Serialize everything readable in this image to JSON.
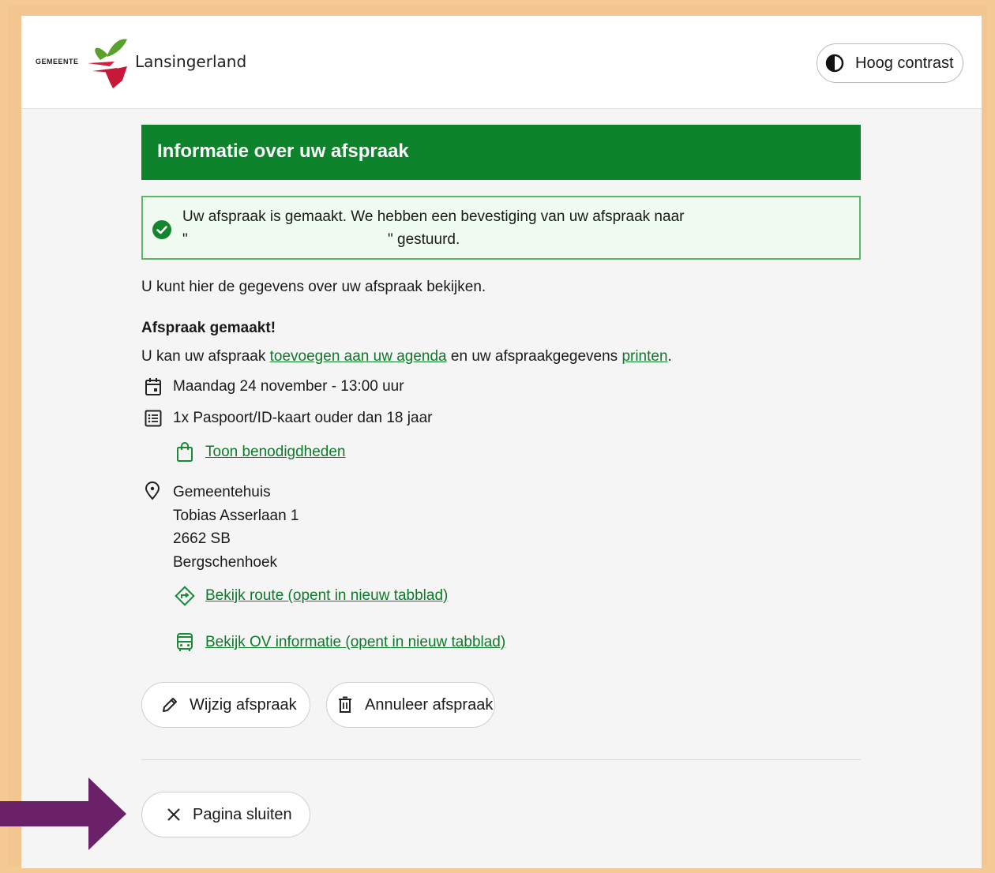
{
  "colors": {
    "accent": "#0d832c",
    "link": "#0d7a29",
    "arrow": "#6b2168",
    "frame": "#f4c68f"
  },
  "header": {
    "logo_small": "GEMEENTE",
    "logo_name": "Lansingerland",
    "contrast_label": "Hoog contrast",
    "contrast_icon": "half-circle-icon"
  },
  "main": {
    "title": "Informatie over uw afspraak",
    "alert": {
      "line1": "Uw afspraak is gemaakt. We hebben een bevestiging van uw afspraak naar",
      "quote_open": "\"",
      "quote_close": "\" gestuurd.",
      "icon": "check-circle-icon"
    },
    "intro": "U kunt hier de gegevens over uw afspraak bekijken.",
    "made_title": "Afspraak gemaakt!",
    "agenda": {
      "prefix": "U kan uw afspraak ",
      "agenda_link": "toevoegen aan uw agenda",
      "middle": " en uw afspraakgegevens ",
      "print_link": "printen",
      "suffix": "."
    },
    "date": "Maandag 24 november - 13:00 uur",
    "product": "1x Paspoort/ID-kaart ouder dan 18 jaar",
    "requirements_link": "Toon benodigdheden",
    "address": {
      "name": "Gemeentehuis",
      "street": "Tobias Asserlaan 1",
      "postal": "2662 SB",
      "city": "Bergschenhoek"
    },
    "route_link": "Bekijk route (opent in nieuw tabblad)",
    "ov_link": "Bekijk OV informatie (opent in nieuw tabblad)",
    "edit_button": "Wijzig afspraak",
    "cancel_button": "Annuleer afspraak",
    "close_button": "Pagina sluiten"
  }
}
